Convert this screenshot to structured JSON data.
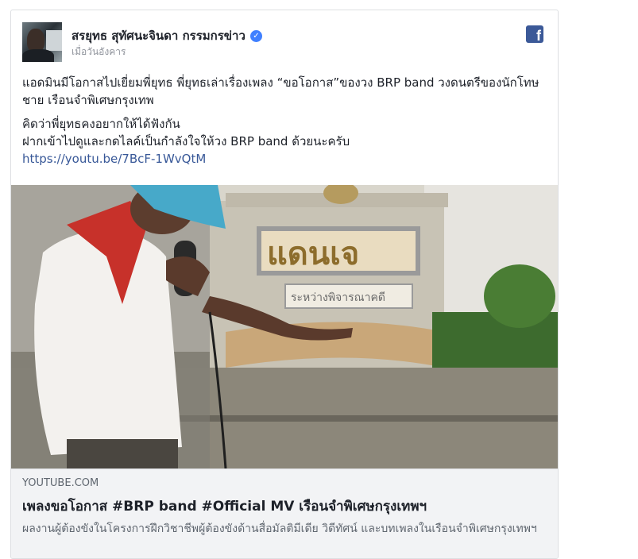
{
  "post": {
    "author": "สรยุทธ สุทัศนะจินดา กรรมกรข่าว",
    "time": "เมื่อวันอังคาร",
    "verified_badge_icon": "verified-check-icon",
    "platform_icon": "facebook-logo-icon",
    "platform_glyph": "f",
    "paragraphs": [
      "แอดมินมีโอกาสไปเยี่ยมพี่ยุทธ พี่ยุทธเล่าเรื่องเพลง “ขอโอกาส”ของวง BRP band วงดนตรีของนักโทษชาย เรือนจำพิเศษกรุงเทพ",
      "คิดว่าพี่ยุทธคงอยากให้ได้ฟังกัน\nฝากเข้าไปดูและกดไลค์เป็นกำลังใจให้วง BRP band ด้วยนะครับ"
    ],
    "link_text": "https://youtu.be/7BcF-1WvQtM"
  },
  "video": {
    "sign_text": "แดนเจ",
    "sign_subtext": "ระหว่างพิจารณาคดี"
  },
  "preview": {
    "domain": "YOUTUBE.COM",
    "title": "เพลงขอโอกาส #BRP band #Official MV เรือนจำพิเศษกรุงเทพฯ",
    "description": "ผลงานผู้ต้องขังในโครงการฝึกวิชาชีพผู้ต้องขังด้านสื่อมัลติมีเดีย วิดีทัศน์ และบทเพลงในเรือนจำพิเศษกรุงเทพฯ"
  },
  "colors": {
    "link": "#385898",
    "facebook_blue": "#3b5998",
    "verified_blue": "#4080ff",
    "preview_bg": "#f2f3f5"
  }
}
